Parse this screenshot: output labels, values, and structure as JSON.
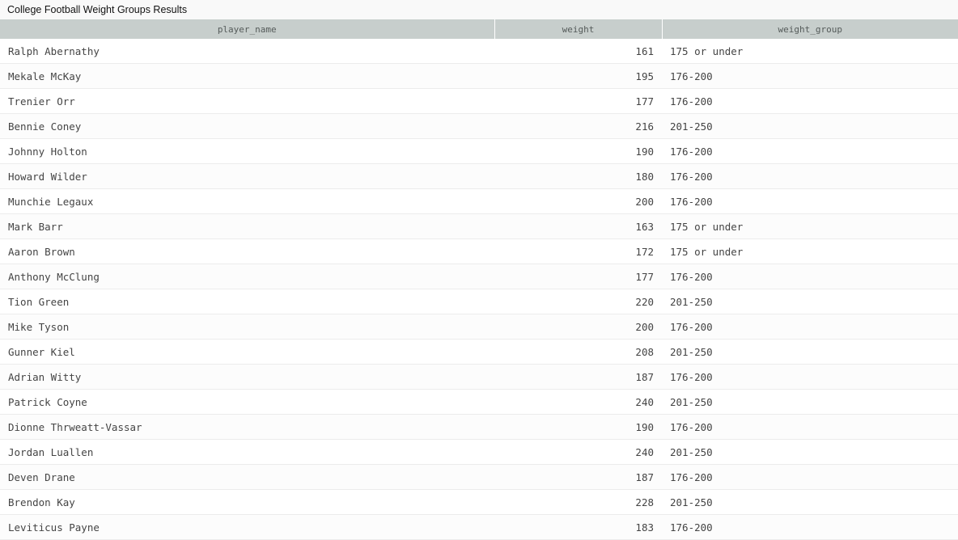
{
  "title": "College Football Weight Groups Results",
  "columns": [
    "player_name",
    "weight",
    "weight_group"
  ],
  "rows": [
    {
      "player_name": "Ralph Abernathy",
      "weight": "161",
      "weight_group": "175 or under"
    },
    {
      "player_name": "Mekale McKay",
      "weight": "195",
      "weight_group": "176-200"
    },
    {
      "player_name": "Trenier Orr",
      "weight": "177",
      "weight_group": "176-200"
    },
    {
      "player_name": "Bennie Coney",
      "weight": "216",
      "weight_group": "201-250"
    },
    {
      "player_name": "Johnny Holton",
      "weight": "190",
      "weight_group": "176-200"
    },
    {
      "player_name": "Howard Wilder",
      "weight": "180",
      "weight_group": "176-200"
    },
    {
      "player_name": "Munchie Legaux",
      "weight": "200",
      "weight_group": "176-200"
    },
    {
      "player_name": "Mark Barr",
      "weight": "163",
      "weight_group": "175 or under"
    },
    {
      "player_name": "Aaron Brown",
      "weight": "172",
      "weight_group": "175 or under"
    },
    {
      "player_name": "Anthony McClung",
      "weight": "177",
      "weight_group": "176-200"
    },
    {
      "player_name": "Tion Green",
      "weight": "220",
      "weight_group": "201-250"
    },
    {
      "player_name": "Mike Tyson",
      "weight": "200",
      "weight_group": "176-200"
    },
    {
      "player_name": "Gunner Kiel",
      "weight": "208",
      "weight_group": "201-250"
    },
    {
      "player_name": "Adrian Witty",
      "weight": "187",
      "weight_group": "176-200"
    },
    {
      "player_name": "Patrick Coyne",
      "weight": "240",
      "weight_group": "201-250"
    },
    {
      "player_name": "Dionne Thrweatt-Vassar",
      "weight": "190",
      "weight_group": "176-200"
    },
    {
      "player_name": "Jordan Luallen",
      "weight": "240",
      "weight_group": "201-250"
    },
    {
      "player_name": "Deven Drane",
      "weight": "187",
      "weight_group": "176-200"
    },
    {
      "player_name": "Brendon Kay",
      "weight": "228",
      "weight_group": "201-250"
    },
    {
      "player_name": "Leviticus Payne",
      "weight": "183",
      "weight_group": "176-200"
    }
  ]
}
